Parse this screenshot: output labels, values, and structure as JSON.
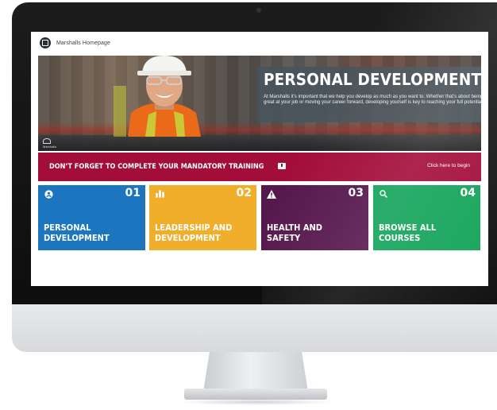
{
  "header": {
    "home_link": "Marshalls Homepage"
  },
  "hero": {
    "title": "PERSONAL DEVELOPMENT",
    "description": "At Marshalls it’s important that we help you develop as much as you want to. Whether that’s about being great at your job or moving your career forward, developing yourself is key to reaching your full potential",
    "logo_text": "Marshalls"
  },
  "banner": {
    "text": "DON’T FORGET TO COMPLETE YOUR MANDATORY TRAINING",
    "cta": "Click here to begin",
    "icon": "message-alert-icon"
  },
  "tiles": [
    {
      "number": "01",
      "label": "PERSONAL DEVELOPMENT",
      "icon": "user-circle-icon",
      "color": "#1b76bf"
    },
    {
      "number": "02",
      "label": "LEADERSHIP AND DEVELOPMENT",
      "icon": "bar-chart-icon",
      "color": "#f1ae2b"
    },
    {
      "number": "03",
      "label": "HEALTH AND SAFETY",
      "icon": "warning-icon",
      "color": "#56174d"
    },
    {
      "number": "04",
      "label": "BROWSE ALL COURSES",
      "icon": "search-icon",
      "color": "#13a45a"
    }
  ]
}
